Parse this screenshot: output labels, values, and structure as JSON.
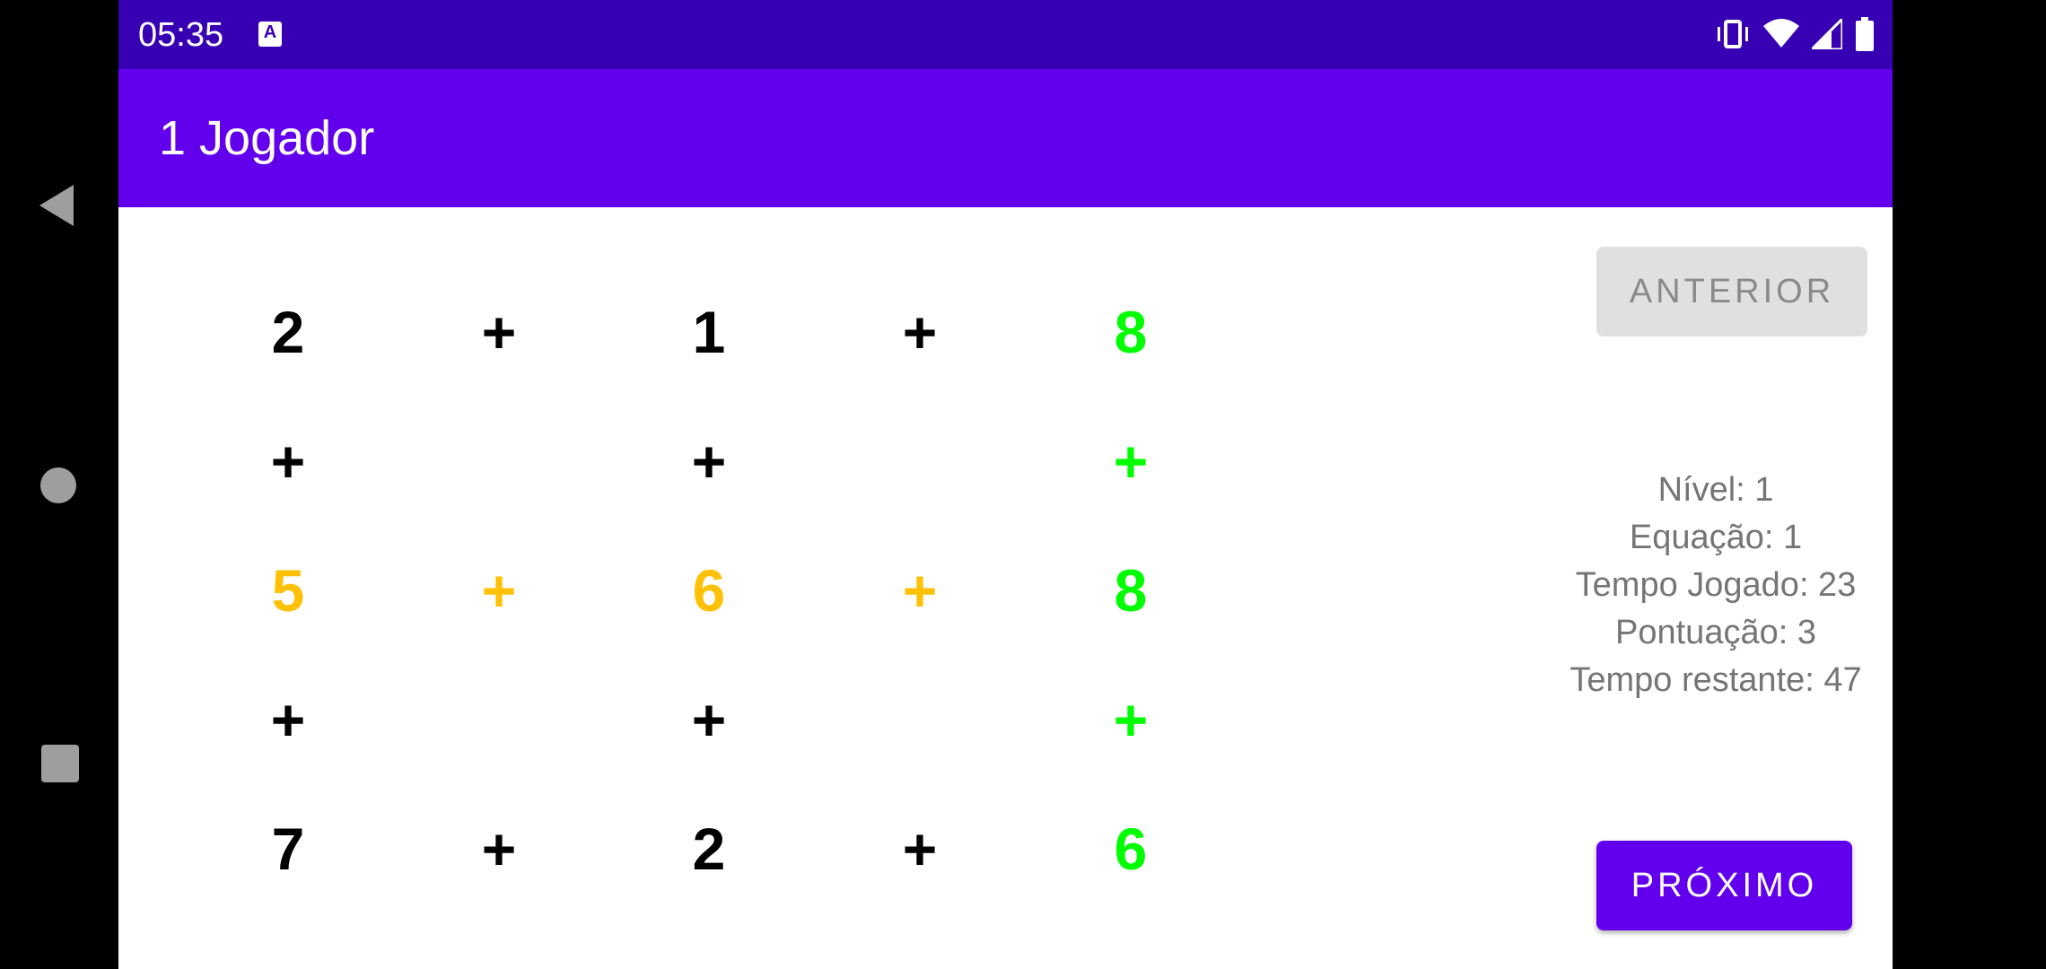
{
  "status_bar": {
    "time": "05:35",
    "notification_icon": "a-icon",
    "icons": [
      "vibrate-icon",
      "wifi-icon",
      "signal-icon",
      "battery-icon"
    ]
  },
  "app_bar": {
    "title": "1 Jogador"
  },
  "grid": {
    "rows": [
      [
        {
          "t": "2",
          "c": "black"
        },
        {
          "t": "+",
          "c": "black"
        },
        {
          "t": "1",
          "c": "black"
        },
        {
          "t": "+",
          "c": "black"
        },
        {
          "t": "8",
          "c": "green"
        }
      ],
      [
        {
          "t": "+",
          "c": "black"
        },
        {
          "t": "",
          "c": "black"
        },
        {
          "t": "+",
          "c": "black"
        },
        {
          "t": "",
          "c": "black"
        },
        {
          "t": "+",
          "c": "green"
        }
      ],
      [
        {
          "t": "5",
          "c": "orange"
        },
        {
          "t": "+",
          "c": "orange"
        },
        {
          "t": "6",
          "c": "orange"
        },
        {
          "t": "+",
          "c": "orange"
        },
        {
          "t": "8",
          "c": "green"
        }
      ],
      [
        {
          "t": "+",
          "c": "black"
        },
        {
          "t": "",
          "c": "black"
        },
        {
          "t": "+",
          "c": "black"
        },
        {
          "t": "",
          "c": "black"
        },
        {
          "t": "+",
          "c": "green"
        }
      ],
      [
        {
          "t": "7",
          "c": "black"
        },
        {
          "t": "+",
          "c": "black"
        },
        {
          "t": "2",
          "c": "black"
        },
        {
          "t": "+",
          "c": "black"
        },
        {
          "t": "6",
          "c": "green"
        }
      ]
    ]
  },
  "buttons": {
    "previous": "ANTERIOR",
    "next": "PRÓXIMO"
  },
  "stats": {
    "level": "Nível: 1",
    "equation": "Equação: 1",
    "time_played": "Tempo Jogado: 23",
    "score": "Pontuação: 3",
    "time_left": "Tempo restante: 47"
  },
  "colors": {
    "primary": "#6200ee",
    "primary_dark": "#3700b3",
    "green": "#00ff00",
    "orange": "#ffc107"
  }
}
